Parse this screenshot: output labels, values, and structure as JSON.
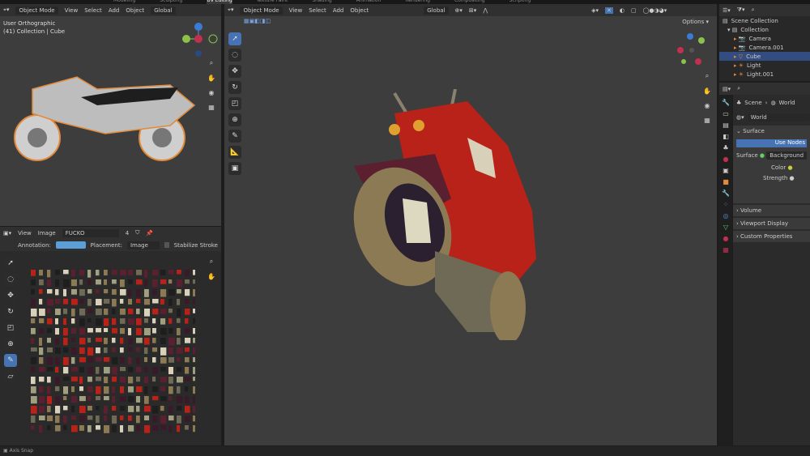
{
  "workspace_tabs": [
    "Modeling",
    "Sculpting",
    "UV Editing",
    "Texture Paint",
    "Shading",
    "Animation",
    "Rendering",
    "Compositing",
    "Scripting"
  ],
  "active_tab": "UV Editing",
  "left_viewport": {
    "mode": "Object Mode",
    "menus": [
      "View",
      "Select",
      "Add",
      "Object"
    ],
    "orientation": "Global",
    "view_name": "User Orthographic",
    "collection_info": "(41) Collection | Cube"
  },
  "main_viewport": {
    "mode": "Object Mode",
    "menus": [
      "View",
      "Select",
      "Add",
      "Object"
    ],
    "orientation": "Global",
    "options_label": "Options"
  },
  "image_editor": {
    "menus": [
      "View",
      "Image"
    ],
    "image_name": "FUCKO",
    "users": "4",
    "annotation_label": "Annotation:",
    "annotation_color": "#5c9fd6",
    "placement_label": "Placement:",
    "placement_value": "Image",
    "stabilize_label": "Stabilize Stroke"
  },
  "outliner": {
    "items": [
      {
        "label": "Scene Collection"
      },
      {
        "label": "Collection"
      },
      {
        "label": "Camera"
      },
      {
        "label": "Camera.001"
      },
      {
        "label": "Cube",
        "selected": true
      },
      {
        "label": "Light"
      },
      {
        "label": "Light.001"
      }
    ]
  },
  "properties": {
    "breadcrumb_scene": "Scene",
    "breadcrumb_world": "World",
    "world_name": "World",
    "surface_panel": "Surface",
    "use_nodes_label": "Use Nodes",
    "surface_label": "Surface",
    "surface_value": "Background",
    "color_label": "Color",
    "strength_label": "Strength",
    "collapsed_panels": [
      "Volume",
      "Viewport Display",
      "Custom Properties"
    ]
  },
  "status_bar": {
    "text": "Axis Snap"
  },
  "colors": {
    "accent": "#4772b3",
    "viewport_bg": "#3d3d3d",
    "selection": "#334d80"
  }
}
